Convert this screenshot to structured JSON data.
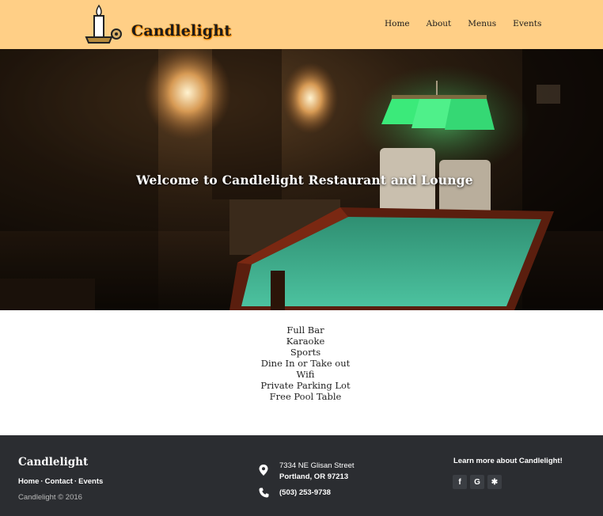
{
  "header": {
    "brand": "Candlelight",
    "nav": [
      "Home",
      "About",
      "Menus",
      "Events"
    ]
  },
  "hero": {
    "title": "Welcome to Candlelight Restaurant and Lounge"
  },
  "features": [
    "Full Bar",
    "Karaoke",
    "Sports",
    "Dine In or Take out",
    "Wifi",
    "Private Parking Lot",
    "Free Pool Table"
  ],
  "footer": {
    "brand": "Candlelight",
    "links": [
      "Home",
      "Contact",
      "Events"
    ],
    "copyright": "Candlelight © 2016",
    "address_line1": "7334 NE Glisan Street",
    "address_line2": "Portland, OR 97213",
    "phone": "(503) 253-9738",
    "about": "Learn more about Candlelight!",
    "social": {
      "facebook": "f",
      "google": "G",
      "yelp": "✱"
    }
  },
  "colors": {
    "header_bg": "#ffcf86",
    "footer_bg": "#2b2d31",
    "pool_felt": "#3fae8f",
    "lamp_green": "#39e07a"
  }
}
